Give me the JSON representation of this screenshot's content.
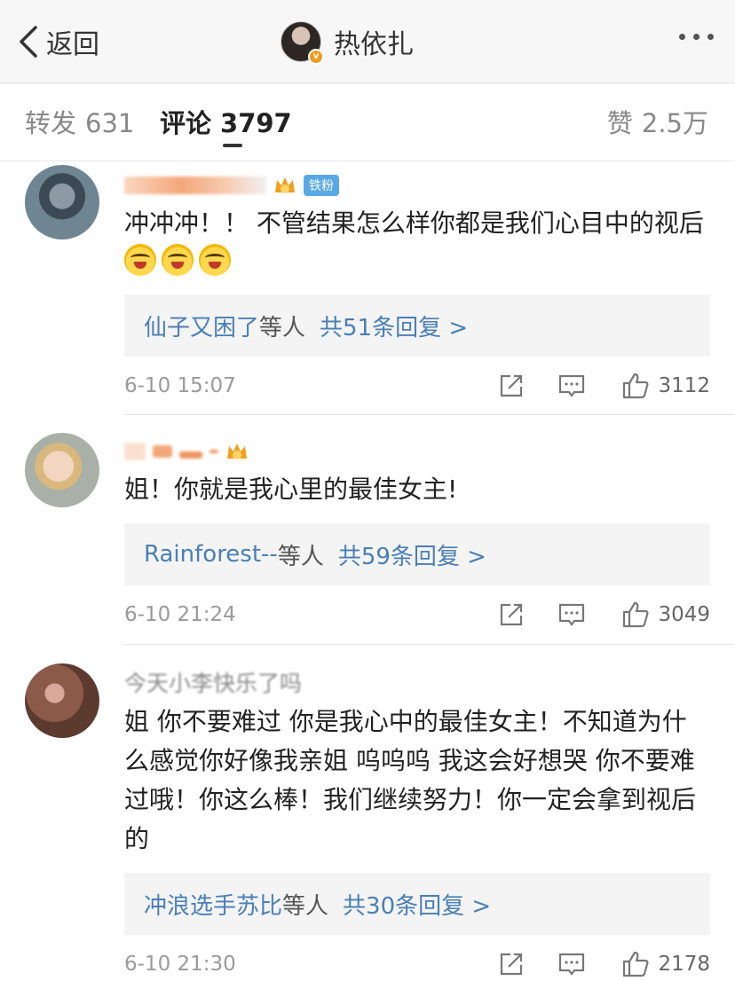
{
  "nav": {
    "back_label": "返回",
    "title": "热依扎",
    "avatar_badge": "v"
  },
  "tabs": {
    "forward_label": "转发",
    "forward_count": "631",
    "comments_label": "评论",
    "comments_count": "3797",
    "likes_label": "赞",
    "likes_count": "2.5万"
  },
  "comments": [
    {
      "username": "y0707070",
      "badge": "铁粉",
      "text": "冲冲冲！！ 不管结果怎么样你都是我们心目中的视后",
      "emoji_count": 3,
      "reply_who": "仙子又困了",
      "reply_mid": "等人",
      "reply_count": "共51条回复 >",
      "time": "6-10 15:07",
      "likes": "3112"
    },
    {
      "username": "",
      "text": "姐！你就是我心里的最佳女主!",
      "reply_who": "Rainforest--",
      "reply_mid": "等人",
      "reply_count": "共59条回复 >",
      "time": "6-10 21:24",
      "likes": "3049"
    },
    {
      "username": "今天小李快乐了吗",
      "text": "姐 你不要难过 你是我心中的最佳女主！不知道为什么感觉你好像我亲姐 呜呜呜 我这会好想哭 你不要难过哦！你这么棒！我们继续努力！你一定会拿到视后的",
      "reply_who": "冲浪选手苏比",
      "reply_mid": "等人",
      "reply_count": "共30条回复 >",
      "time": "6-10 21:30",
      "likes": "2178"
    }
  ],
  "icons": [
    "chevron-left-icon",
    "more-icon",
    "share-icon",
    "comment-icon",
    "like-icon",
    "crown-icon"
  ],
  "colors": {
    "link": "#4a7fb5",
    "fan_badge": "#5aa9e6",
    "crown": "#f0a020"
  }
}
